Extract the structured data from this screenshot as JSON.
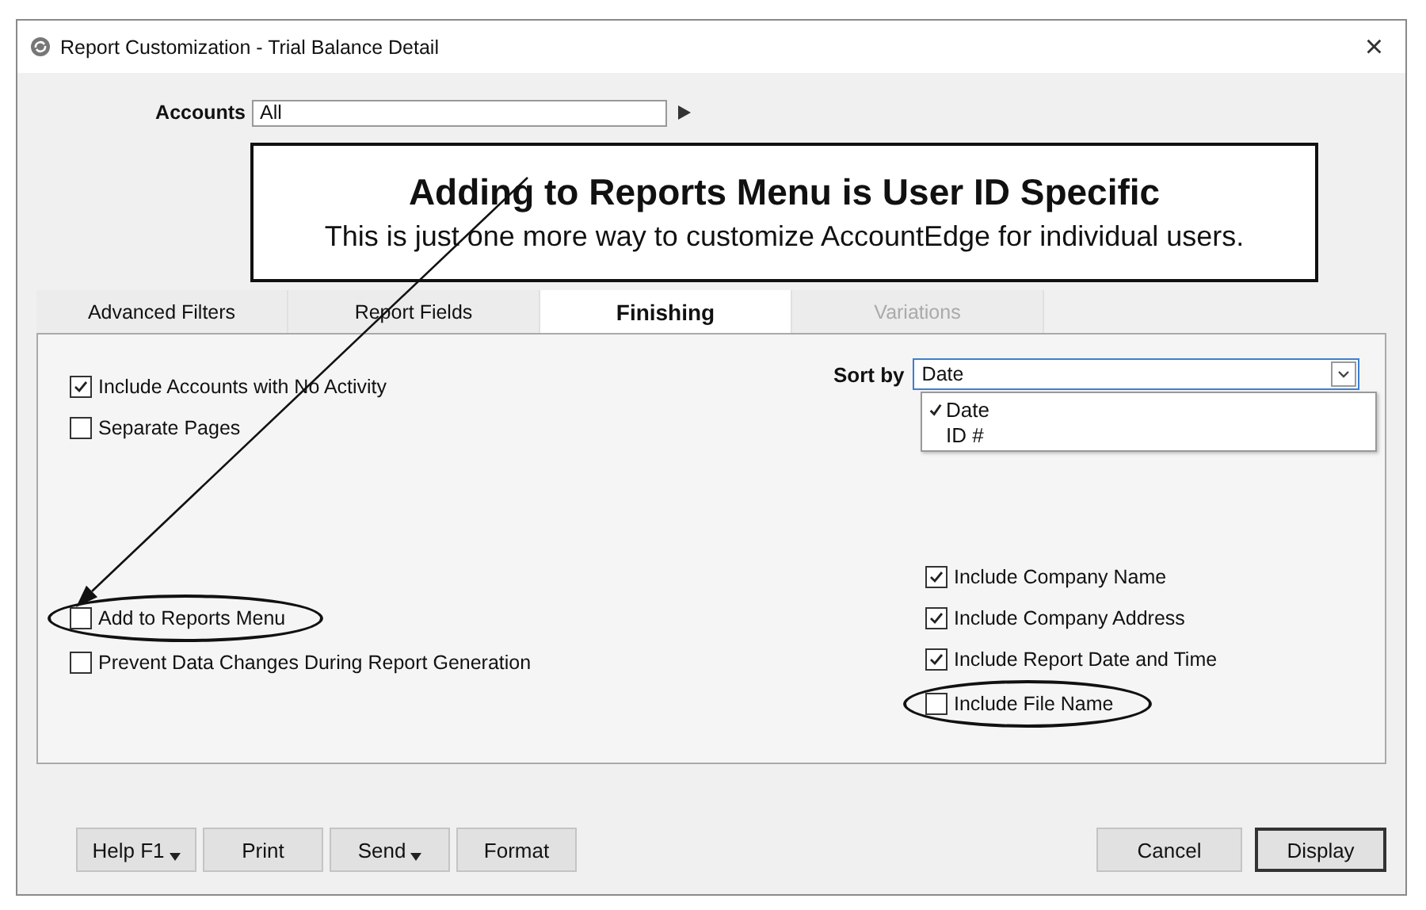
{
  "window": {
    "title": "Report Customization - Trial Balance Detail",
    "close": "×"
  },
  "accounts": {
    "label": "Accounts",
    "value": "All"
  },
  "callout": {
    "title": "Adding to Reports Menu is User ID Specific",
    "text": "This is just one more way to customize AccountEdge for individual users."
  },
  "tabs": [
    {
      "label": "Advanced Filters",
      "selected": false,
      "disabled": false
    },
    {
      "label": "Report Fields",
      "selected": false,
      "disabled": false
    },
    {
      "label": "Finishing",
      "selected": true,
      "disabled": false
    },
    {
      "label": "Variations",
      "selected": false,
      "disabled": true
    }
  ],
  "left_options_top": [
    {
      "label": "Include Accounts with No Activity",
      "checked": true,
      "circled": false
    },
    {
      "label": "Separate Pages",
      "checked": false,
      "circled": false
    }
  ],
  "left_options_bottom": [
    {
      "label": "Add to Reports Menu",
      "checked": false,
      "circled": true
    },
    {
      "label": "Prevent Data Changes During Report Generation",
      "checked": false,
      "circled": false
    }
  ],
  "sort": {
    "label": "Sort by",
    "value": "Date",
    "expanded": true,
    "options": [
      {
        "label": "Date",
        "selected": true
      },
      {
        "label": "ID #",
        "selected": false
      }
    ]
  },
  "right_options": [
    {
      "label": "Include Company Name",
      "checked": true,
      "circled": false
    },
    {
      "label": "Include Company Address",
      "checked": true,
      "circled": false
    },
    {
      "label": "Include Report Date and Time",
      "checked": true,
      "circled": false
    },
    {
      "label": "Include File Name",
      "checked": false,
      "circled": true
    }
  ],
  "buttons_left": [
    {
      "label": "Help F1",
      "menu": true
    },
    {
      "label": "Print",
      "menu": false
    },
    {
      "label": "Send",
      "menu": true
    },
    {
      "label": "Format",
      "menu": false
    }
  ],
  "buttons_right": [
    {
      "label": "Cancel",
      "default": false
    },
    {
      "label": "Display",
      "default": true
    }
  ]
}
